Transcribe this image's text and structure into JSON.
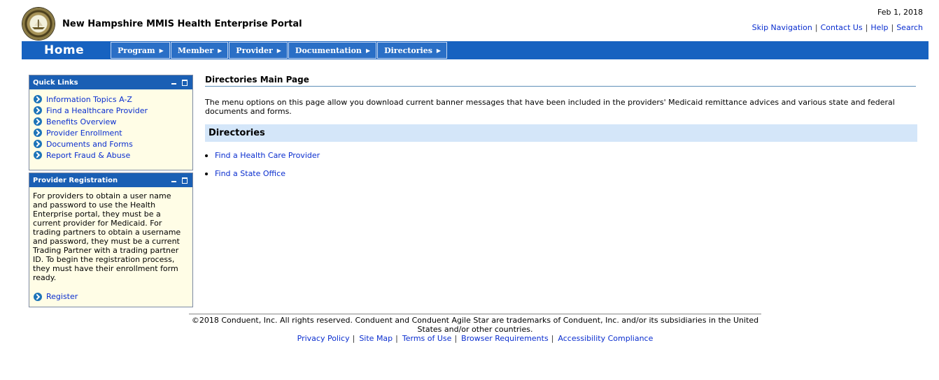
{
  "header": {
    "title": "New Hampshire MMIS Health Enterprise Portal",
    "date": "Feb 1, 2018",
    "util_links": [
      "Skip Navigation",
      "Contact Us",
      "Help",
      "Search"
    ]
  },
  "nav": {
    "home": "Home",
    "menu": [
      "Program",
      "Member",
      "Provider",
      "Documentation",
      "Directories"
    ]
  },
  "quick_links": {
    "title": "Quick Links",
    "items": [
      "Information Topics A-Z",
      "Find a Healthcare Provider",
      "Benefits Overview",
      "Provider Enrollment",
      "Documents and Forms",
      "Report Fraud & Abuse"
    ]
  },
  "provider_registration": {
    "title": "Provider Registration",
    "text": "For providers to obtain a user name and password to use the Health Enterprise portal, they must be a current provider for Medicaid. For trading partners to obtain a username and password, they must be a current Trading Partner with a trading partner ID. To begin the registration process, they must have their enrollment form ready.",
    "link": "Register"
  },
  "main": {
    "title": "Directories Main Page",
    "intro": "The menu options on this page allow you download current banner messages that have been included in the providers' Medicaid remittance advices and various state and federal documents and forms.",
    "section_title": "Directories",
    "links": [
      "Find a Health Care Provider",
      "Find a State Office"
    ]
  },
  "footer": {
    "copyright": "©2018 Conduent, Inc. All rights reserved. Conduent and Conduent Agile Star are trademarks of Conduent, Inc. and/or its subsidiaries in the United States and/or other countries.",
    "links": [
      "Privacy Policy",
      "Site Map",
      "Terms of Use",
      "Browser Requirements",
      "Accessibility Compliance"
    ]
  },
  "colors": {
    "nav_bar": "#1762c0",
    "panel_header": "#1a5fb4",
    "panel_bg": "#fffde6",
    "section_band": "#d4e6f9",
    "link": "#0a2ecf"
  },
  "icons": [
    "state-seal-icon",
    "chevron-right-icon",
    "minimize-icon",
    "maximize-icon",
    "arrow-bullet-icon"
  ]
}
